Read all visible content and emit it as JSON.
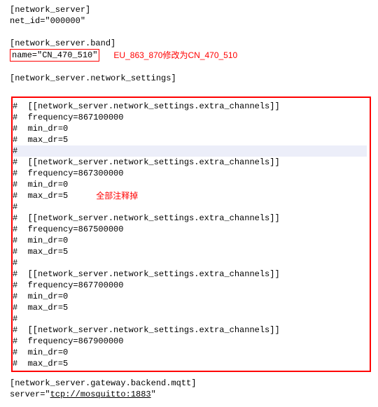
{
  "header": {
    "section1": "[network_server]",
    "net_id": "net_id=\"000000\"",
    "section2": "[network_server.band]",
    "name_line": "name=\"CN_470_510\"",
    "section3": "[network_server.network_settings]"
  },
  "annotations": {
    "band_note": "EU_863_870修改为CN_470_510",
    "comment_all": "全部注释掉"
  },
  "channels": [
    {
      "head": "  [[network_server.network_settings.extra_channels]]",
      "freq": "  frequency=867100000",
      "min": "  min_dr=0",
      "max": "  max_dr=5"
    },
    {
      "head": "  [[network_server.network_settings.extra_channels]]",
      "freq": "  frequency=867300000",
      "min": "  min_dr=0",
      "max": "  max_dr=5"
    },
    {
      "head": "  [[network_server.network_settings.extra_channels]]",
      "freq": "  frequency=867500000",
      "min": "  min_dr=0",
      "max": "  max_dr=5"
    },
    {
      "head": "  [[network_server.network_settings.extra_channels]]",
      "freq": "  frequency=867700000",
      "min": "  min_dr=0",
      "max": "  max_dr=5"
    },
    {
      "head": "  [[network_server.network_settings.extra_channels]]",
      "freq": "  frequency=867900000",
      "min": "  min_dr=0",
      "max": "  max_dr=5"
    }
  ],
  "hash": "#",
  "footer": {
    "section": "[network_server.gateway.backend.mqtt]",
    "server_prefix": "server=\"",
    "server_url": "tcp://mosquitto:1883",
    "server_suffix": "\""
  }
}
